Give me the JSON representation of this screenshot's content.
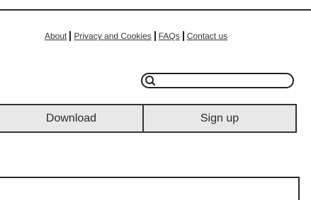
{
  "links": [
    {
      "label": "About"
    },
    {
      "label": "Privacy and Cookies"
    },
    {
      "label": "FAQs"
    },
    {
      "label": "Contact us"
    }
  ],
  "search": {
    "placeholder": "",
    "value": ""
  },
  "buttons": {
    "download_label": "Download",
    "signup_label": "Sign up"
  },
  "icons": {
    "search": "search-icon"
  }
}
